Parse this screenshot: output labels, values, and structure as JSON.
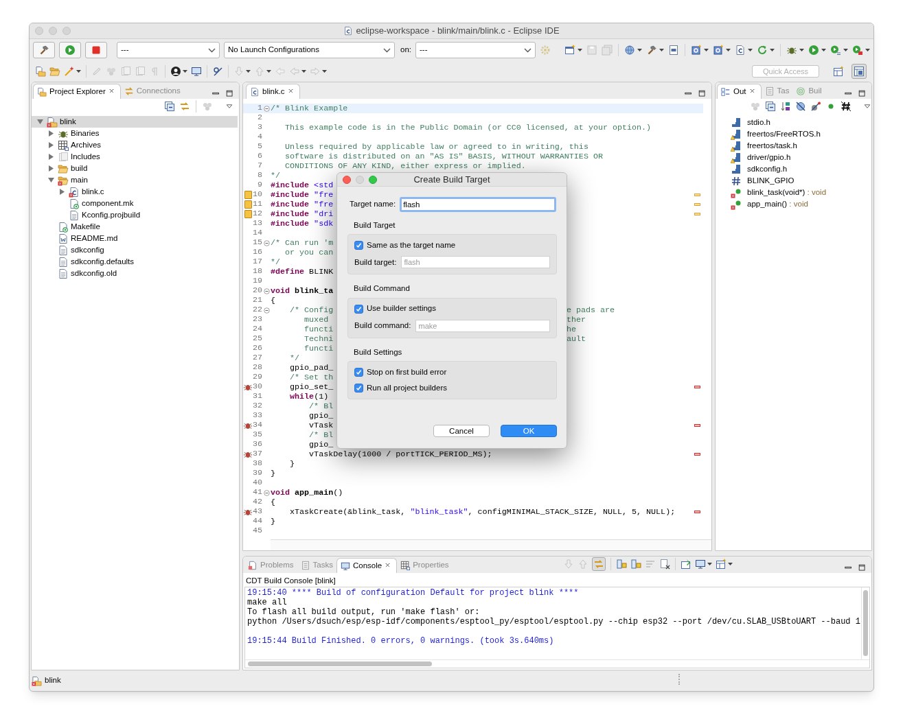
{
  "window": {
    "title": "eclipse-workspace - blink/main/blink.c - Eclipse IDE"
  },
  "toolbar": {
    "mode_combo": "---",
    "launch_combo": "No Launch Configurations",
    "target_label": "on:",
    "target_combo": "---",
    "quick_access": {
      "placeholder": "Quick Access"
    }
  },
  "left_panel": {
    "tabs": [
      {
        "label": "Project Explorer",
        "kind": "explorer",
        "selected": true
      },
      {
        "label": "Connections",
        "kind": "connections",
        "selected": false
      }
    ],
    "tree": [
      {
        "label": "blink",
        "kind": "project",
        "error": true,
        "selected": true,
        "expanded": true,
        "children": [
          {
            "label": "Binaries",
            "kind": "binaries",
            "error": false,
            "selected": false,
            "expanded": false
          },
          {
            "label": "Archives",
            "kind": "archives",
            "error": false,
            "selected": false,
            "expanded": false
          },
          {
            "label": "Includes",
            "kind": "includes",
            "error": false,
            "selected": false,
            "expanded": false
          },
          {
            "label": "build",
            "kind": "folder",
            "error": false,
            "selected": false,
            "expanded": false
          },
          {
            "label": "main",
            "kind": "folder",
            "error": true,
            "selected": false,
            "expanded": true,
            "children": [
              {
                "label": "blink.c",
                "kind": "c-file",
                "error": true,
                "selected": false,
                "expanded": false
              },
              {
                "label": "component.mk",
                "kind": "make-file",
                "error": false,
                "selected": false
              },
              {
                "label": "Kconfig.projbuild",
                "kind": "text-file",
                "error": false,
                "selected": false
              }
            ]
          },
          {
            "label": "Makefile",
            "kind": "make-file",
            "error": false,
            "selected": false
          },
          {
            "label": "README.md",
            "kind": "readme",
            "error": false,
            "selected": false
          },
          {
            "label": "sdkconfig",
            "kind": "text-file",
            "error": false,
            "selected": false
          },
          {
            "label": "sdkconfig.defaults",
            "kind": "text-file",
            "error": false,
            "selected": false
          },
          {
            "label": "sdkconfig.old",
            "kind": "text-file",
            "error": false,
            "selected": false
          }
        ]
      }
    ]
  },
  "editor": {
    "tabs": [
      {
        "label": "blink.c",
        "kind": "c-file",
        "selected": true
      }
    ],
    "lines": [
      {
        "n": "1",
        "fold": true,
        "current": true,
        "tokens": [
          {
            "kind": "comment",
            "text": "/* Blink Example"
          }
        ]
      },
      {
        "n": "2",
        "fold": false,
        "current": false
      },
      {
        "n": "3",
        "fold": false,
        "current": false,
        "tokens": [
          {
            "kind": "comment",
            "text": "   This example code is in the Public Domain (or CC0 licensed, at your option.)"
          }
        ]
      },
      {
        "n": "4",
        "fold": false,
        "current": false
      },
      {
        "n": "5",
        "fold": false,
        "current": false,
        "tokens": [
          {
            "kind": "comment",
            "text": "   Unless required by applicable law or agreed to in writing, this"
          }
        ]
      },
      {
        "n": "6",
        "fold": false,
        "current": false,
        "tokens": [
          {
            "kind": "comment",
            "text": "   software is distributed on an \"AS IS\" BASIS, WITHOUT WARRANTIES OR"
          }
        ]
      },
      {
        "n": "7",
        "fold": false,
        "current": false,
        "tokens": [
          {
            "kind": "comment",
            "text": "   CONDITIONS OF ANY KIND, either express or implied."
          }
        ]
      },
      {
        "n": "8",
        "fold": false,
        "current": false,
        "tokens": [
          {
            "kind": "comment",
            "text": "*/"
          }
        ]
      },
      {
        "n": "9",
        "fold": false,
        "current": false,
        "tokens": [
          {
            "kind": "keyword",
            "text": "#include"
          },
          {
            "kind": "string",
            "text": " <std"
          }
        ]
      },
      {
        "n": "10",
        "fold": false,
        "current": false,
        "marker": {
          "kind": "warning"
        },
        "tokens": [
          {
            "kind": "keyword",
            "text": "#include"
          },
          {
            "kind": "string",
            "text": " \"fre"
          }
        ]
      },
      {
        "n": "11",
        "fold": false,
        "current": false,
        "marker": {
          "kind": "warning"
        },
        "tokens": [
          {
            "kind": "keyword",
            "text": "#include"
          },
          {
            "kind": "string",
            "text": " \"fre"
          }
        ]
      },
      {
        "n": "12",
        "fold": false,
        "current": false,
        "marker": {
          "kind": "warning"
        },
        "tokens": [
          {
            "kind": "keyword",
            "text": "#include"
          },
          {
            "kind": "string",
            "text": " \"dri"
          }
        ]
      },
      {
        "n": "13",
        "fold": false,
        "current": false,
        "tokens": [
          {
            "kind": "keyword",
            "text": "#include"
          },
          {
            "kind": "string",
            "text": " \"sdk"
          }
        ]
      },
      {
        "n": "14",
        "fold": false,
        "current": false
      },
      {
        "n": "15",
        "fold": true,
        "current": false,
        "tokens": [
          {
            "kind": "comment",
            "text": "/* Can run 'm"
          }
        ]
      },
      {
        "n": "16",
        "fold": false,
        "current": false,
        "tokens": [
          {
            "kind": "comment",
            "text": "   or you can"
          }
        ]
      },
      {
        "n": "17",
        "fold": false,
        "current": false,
        "tokens": [
          {
            "kind": "comment",
            "text": "*/"
          }
        ]
      },
      {
        "n": "18",
        "fold": false,
        "current": false,
        "tokens": [
          {
            "kind": "keyword",
            "text": "#define"
          },
          {
            "kind": "plain",
            "text": " BLINK"
          }
        ]
      },
      {
        "n": "19",
        "fold": false,
        "current": false
      },
      {
        "n": "20",
        "fold": true,
        "current": false,
        "tokens": [
          {
            "kind": "keyword",
            "text": "void"
          },
          {
            "kind": "bold",
            "text": " blink_ta"
          }
        ]
      },
      {
        "n": "21",
        "fold": false,
        "current": false,
        "tokens": [
          {
            "kind": "plain",
            "text": "{"
          }
        ]
      },
      {
        "n": "22",
        "fold": true,
        "current": false,
        "tokens": [
          {
            "kind": "comment",
            "text": "    /* Config"
          }
        ],
        "tail": [
          {
            "kind": "comment",
            "text": "e pads are"
          }
        ]
      },
      {
        "n": "23",
        "fold": false,
        "current": false,
        "tokens": [
          {
            "kind": "comment",
            "text": "       muxed"
          }
        ],
        "tail": [
          {
            "kind": "comment",
            "text": "ther"
          }
        ]
      },
      {
        "n": "24",
        "fold": false,
        "current": false,
        "tokens": [
          {
            "kind": "comment",
            "text": "       functi"
          }
        ],
        "tail": [
          {
            "kind": "comment",
            "text": "he"
          }
        ]
      },
      {
        "n": "25",
        "fold": false,
        "current": false,
        "tokens": [
          {
            "kind": "comment",
            "text": "       Techni"
          }
        ],
        "tail": [
          {
            "kind": "comment",
            "text": "ault"
          }
        ]
      },
      {
        "n": "26",
        "fold": false,
        "current": false,
        "tokens": [
          {
            "kind": "comment",
            "text": "       functi"
          }
        ]
      },
      {
        "n": "27",
        "fold": false,
        "current": false,
        "tokens": [
          {
            "kind": "comment",
            "text": "    */"
          }
        ]
      },
      {
        "n": "28",
        "fold": false,
        "current": false,
        "tokens": [
          {
            "kind": "plain",
            "text": "    gpio_pad_"
          }
        ]
      },
      {
        "n": "29",
        "fold": false,
        "current": false,
        "tokens": [
          {
            "kind": "comment",
            "text": "    /* Set th"
          }
        ]
      },
      {
        "n": "30",
        "fold": false,
        "current": false,
        "marker": {
          "kind": "bug"
        },
        "tokens": [
          {
            "kind": "plain",
            "text": "    gpio_set_"
          }
        ]
      },
      {
        "n": "31",
        "fold": false,
        "current": false,
        "tokens": [
          {
            "kind": "keyword",
            "text": "    while"
          },
          {
            "kind": "plain",
            "text": "(1)"
          }
        ]
      },
      {
        "n": "32",
        "fold": false,
        "current": false,
        "tokens": [
          {
            "kind": "comment",
            "text": "        /* Bl"
          }
        ]
      },
      {
        "n": "33",
        "fold": false,
        "current": false,
        "tokens": [
          {
            "kind": "plain",
            "text": "        gpio_"
          }
        ]
      },
      {
        "n": "34",
        "fold": false,
        "current": false,
        "marker": {
          "kind": "bug"
        },
        "tokens": [
          {
            "kind": "plain",
            "text": "        vTask"
          }
        ]
      },
      {
        "n": "35",
        "fold": false,
        "current": false,
        "tokens": [
          {
            "kind": "comment",
            "text": "        /* Bl"
          }
        ]
      },
      {
        "n": "36",
        "fold": false,
        "current": false,
        "tokens": [
          {
            "kind": "plain",
            "text": "        gpio_"
          }
        ]
      },
      {
        "n": "37",
        "fold": false,
        "current": false,
        "marker": {
          "kind": "bug"
        },
        "tokens": [
          {
            "kind": "plain",
            "text": "        vTaskDelay(1000 / portTICK_PERIOD_MS);"
          }
        ]
      },
      {
        "n": "38",
        "fold": false,
        "current": false,
        "tokens": [
          {
            "kind": "plain",
            "text": "    }"
          }
        ]
      },
      {
        "n": "39",
        "fold": false,
        "current": false,
        "tokens": [
          {
            "kind": "plain",
            "text": "}"
          }
        ]
      },
      {
        "n": "40",
        "fold": false,
        "current": false
      },
      {
        "n": "41",
        "fold": true,
        "current": false,
        "tokens": [
          {
            "kind": "keyword",
            "text": "void"
          },
          {
            "kind": "bold",
            "text": " app_main"
          },
          {
            "kind": "plain",
            "text": "()"
          }
        ]
      },
      {
        "n": "42",
        "fold": false,
        "current": false,
        "tokens": [
          {
            "kind": "plain",
            "text": "{"
          }
        ]
      },
      {
        "n": "43",
        "fold": false,
        "current": false,
        "marker": {
          "kind": "bug"
        },
        "tokens": [
          {
            "kind": "plain",
            "text": "    xTaskCreate(&blink_task, "
          },
          {
            "kind": "string",
            "text": "\"blink_task\""
          },
          {
            "kind": "plain",
            "text": ", configMINIMAL_STACK_SIZE, NULL, 5, NULL);"
          }
        ]
      },
      {
        "n": "44",
        "fold": false,
        "current": false,
        "tokens": [
          {
            "kind": "plain",
            "text": "}"
          }
        ]
      },
      {
        "n": "45",
        "fold": false,
        "current": false
      }
    ]
  },
  "outline": {
    "tabs": [
      {
        "label": "Out",
        "kind": "outline",
        "selected": true
      },
      {
        "label": "Tas",
        "kind": "tasks",
        "selected": false
      },
      {
        "label": "Buil",
        "kind": "build-targets",
        "selected": false
      }
    ],
    "items": [
      {
        "name": "stdio.h",
        "kind": "include",
        "warning": false,
        "error": false
      },
      {
        "name": "freertos/FreeRTOS.h",
        "kind": "include",
        "warning": true,
        "error": false
      },
      {
        "name": "freertos/task.h",
        "kind": "include",
        "warning": true,
        "error": false
      },
      {
        "name": "driver/gpio.h",
        "kind": "include",
        "warning": true,
        "error": false
      },
      {
        "name": "sdkconfig.h",
        "kind": "include",
        "warning": false,
        "error": false
      },
      {
        "name": "BLINK_GPIO",
        "kind": "macro",
        "warning": false,
        "error": false
      },
      {
        "name": "blink_task(void*)",
        "type": ": void",
        "kind": "function",
        "warning": false,
        "error": true
      },
      {
        "name": "app_main()",
        "type": ": void",
        "kind": "function",
        "warning": false,
        "error": true
      }
    ]
  },
  "console": {
    "tabs": [
      {
        "label": "Problems",
        "kind": "problems",
        "selected": false
      },
      {
        "label": "Tasks",
        "kind": "tasks",
        "selected": false
      },
      {
        "label": "Console",
        "kind": "console",
        "selected": true
      },
      {
        "label": "Properties",
        "kind": "properties",
        "selected": false
      }
    ],
    "title": "CDT Build Console [blink]",
    "lines": [
      {
        "kind": "info",
        "text": "19:15:40 **** Build of configuration Default for project blink ****"
      },
      {
        "kind": "output",
        "text": "make all"
      },
      {
        "kind": "output",
        "text": "To flash all build output, run 'make flash' or:"
      },
      {
        "kind": "output",
        "text": "python /Users/dsuch/esp/esp-idf/components/esptool_py/esptool/esptool.py --chip esp32 --port /dev/cu.SLAB_USBtoUART --baud 1"
      },
      {
        "kind": "blank"
      },
      {
        "kind": "info",
        "text": "19:15:44 Build Finished. 0 errors, 0 warnings. (took 3s.640ms)"
      }
    ]
  },
  "dialog": {
    "title": "Create Build Target",
    "target_name": {
      "label": "Target name:",
      "value": "flash"
    },
    "groups": [
      {
        "title": "Build Target",
        "rows": [
          {
            "kind": "checkbox",
            "label": "Same as the target name",
            "checked": true
          },
          {
            "kind": "field",
            "label": "Build target:",
            "value": "flash",
            "disabled": true
          }
        ]
      },
      {
        "title": "Build Command",
        "rows": [
          {
            "kind": "checkbox",
            "label": "Use builder settings",
            "checked": true
          },
          {
            "kind": "field",
            "label": "Build command:",
            "value": "make",
            "disabled": true
          }
        ]
      },
      {
        "title": "Build Settings",
        "rows": [
          {
            "kind": "checkbox",
            "label": "Stop on first build error",
            "checked": true
          },
          {
            "kind": "checkbox",
            "label": "Run all project builders",
            "checked": true
          }
        ]
      }
    ],
    "buttons": [
      {
        "label": "Cancel",
        "default": false
      },
      {
        "label": "OK",
        "default": true
      }
    ]
  },
  "status_bar": {
    "text": "blink"
  }
}
